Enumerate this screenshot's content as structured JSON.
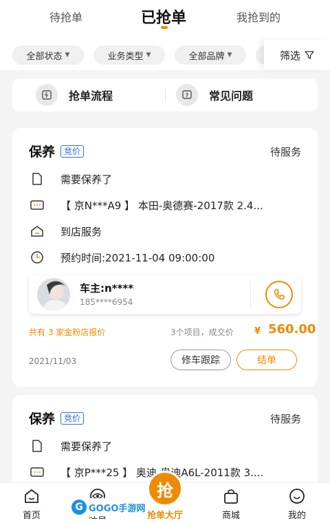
{
  "tabs": [
    {
      "label": "待抢单",
      "active": false
    },
    {
      "label": "已抢单",
      "active": true
    },
    {
      "label": "我抢到的",
      "active": false
    }
  ],
  "filters": {
    "chips": [
      "全部状态",
      "业务类型",
      "全部品牌"
    ],
    "filter_label": "筛选"
  },
  "quick_actions": {
    "flow": "抢单流程",
    "faq": "常见问题"
  },
  "orders": [
    {
      "title": "保养",
      "badge": "竞价",
      "status": "待服务",
      "need": "需要保养了",
      "car": "【 京N***A9 】 本田-奥德赛-2017款 2.4...",
      "service": "到店服务",
      "appointment": "预约时间:2021-11-04 09:00:00",
      "owner_name": "车主:n****",
      "owner_phone": "185****6954",
      "shops_quote": "共有 3 家金粉店报价",
      "items_info": "3个项目，成交价",
      "price_currency": "¥",
      "price": "560.00",
      "date": "2021/11/03",
      "btn_track": "修车跟踪",
      "btn_finish": "结单"
    },
    {
      "title": "保养",
      "badge": "竞价",
      "status": "待服务",
      "need": "需要保养了",
      "car": "【 京P***25 】 奥迪-奥迪A6L-2011款 3...."
    }
  ],
  "bottom_nav": {
    "home": "首页",
    "business": "经营",
    "grab_hall": "抢单大厅",
    "grab_icon_char": "抢",
    "mall": "商城",
    "mine": "我的"
  },
  "watermark": {
    "letter": "G",
    "text": "GOGO手游网"
  },
  "colors": {
    "accent": "#f08a00",
    "badge_blue": "#2f6fd6",
    "background": "#f4f4f4"
  }
}
